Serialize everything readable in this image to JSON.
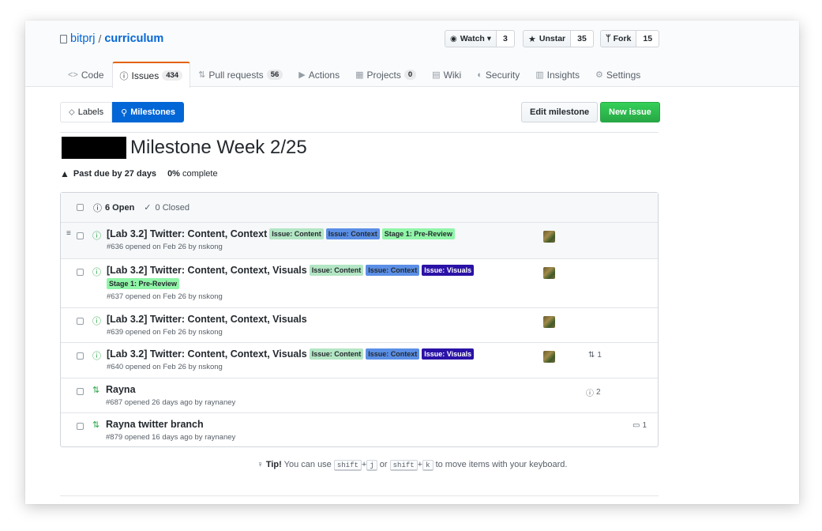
{
  "repo": {
    "owner": "bitprj",
    "separator": "/",
    "name": "curriculum"
  },
  "actions": [
    {
      "icon": "eye-icon",
      "glyph": "◉",
      "label": "Watch ▾",
      "count": "3"
    },
    {
      "icon": "star-icon",
      "glyph": "★",
      "label": "Unstar",
      "count": "35"
    },
    {
      "icon": "fork-icon",
      "glyph": "ᛘ",
      "label": "Fork",
      "count": "15"
    }
  ],
  "tabs": [
    {
      "icon": "code-icon",
      "glyph": "<>",
      "label": "Code",
      "count": ""
    },
    {
      "icon": "issue-icon",
      "glyph": "ⓘ",
      "label": "Issues",
      "count": "434"
    },
    {
      "icon": "pull-request-icon",
      "glyph": "⇅",
      "label": "Pull requests",
      "count": "56"
    },
    {
      "icon": "actions-icon",
      "glyph": "▶",
      "label": "Actions",
      "count": ""
    },
    {
      "icon": "projects-icon",
      "glyph": "▦",
      "label": "Projects",
      "count": "0"
    },
    {
      "icon": "wiki-icon",
      "glyph": "▤",
      "label": "Wiki",
      "count": ""
    },
    {
      "icon": "shield-icon",
      "glyph": "◐",
      "label": "Security",
      "count": ""
    },
    {
      "icon": "graph-icon",
      "glyph": "▥",
      "label": "Insights",
      "count": ""
    },
    {
      "icon": "gear-icon",
      "glyph": "⚙",
      "label": "Settings",
      "count": ""
    }
  ],
  "subnav": {
    "labels": "Labels",
    "milestones": "Milestones"
  },
  "buttons": {
    "edit": "Edit milestone",
    "new": "New issue"
  },
  "milestone": {
    "title": "Milestone Week 2/25",
    "past_due": "Past due by 27 days",
    "percent": "0%",
    "complete": "complete"
  },
  "filters": {
    "open": "6 Open",
    "closed": "0 Closed"
  },
  "issues": [
    {
      "title": "[Lab 3.2] Twitter: Content, Context",
      "sub": "#636 opened on Feb 26 by nskong",
      "type": "issue"
    },
    {
      "title": "[Lab 3.2] Twitter: Content, Context, Visuals",
      "sub": "#637 opened on Feb 26 by nskong",
      "type": "issue"
    },
    {
      "title": "[Lab 3.2] Twitter: Content, Context, Visuals",
      "sub": "#639 opened on Feb 26 by nskong",
      "type": "issue"
    },
    {
      "title": "[Lab 3.2] Twitter: Content, Context, Visuals",
      "sub": "#640 opened on Feb 26 by nskong",
      "type": "issue",
      "linked_prs": "1"
    },
    {
      "title": "Rayna",
      "sub": "#687 opened 26 days ago by raynaney",
      "type": "pr",
      "linked_issues": "2"
    },
    {
      "title": "Rayna twitter branch",
      "sub": "#879 opened 16 days ago by raynaney",
      "type": "pr",
      "comments": "1"
    }
  ],
  "labels": {
    "content": "Issue: Content",
    "context": "Issue: Context",
    "visuals": "Issue: Visuals",
    "stage": "Stage 1: Pre-Review"
  },
  "tip": {
    "prefix": "Tip!",
    "text1": "You can use",
    "k1": "shift",
    "plus": "+",
    "k2": "j",
    "or": "or",
    "k3": "shift",
    "k4": "k",
    "text2": "to move items with your keyboard."
  },
  "colors": {
    "link": "#0366d6",
    "open_green": "#28a745",
    "selected_tab_border": "#e36209",
    "label_content": "#b3e6c4",
    "label_context": "#5b8fe6",
    "label_visuals": "#2b12a6",
    "label_stage": "#90f5a8"
  }
}
